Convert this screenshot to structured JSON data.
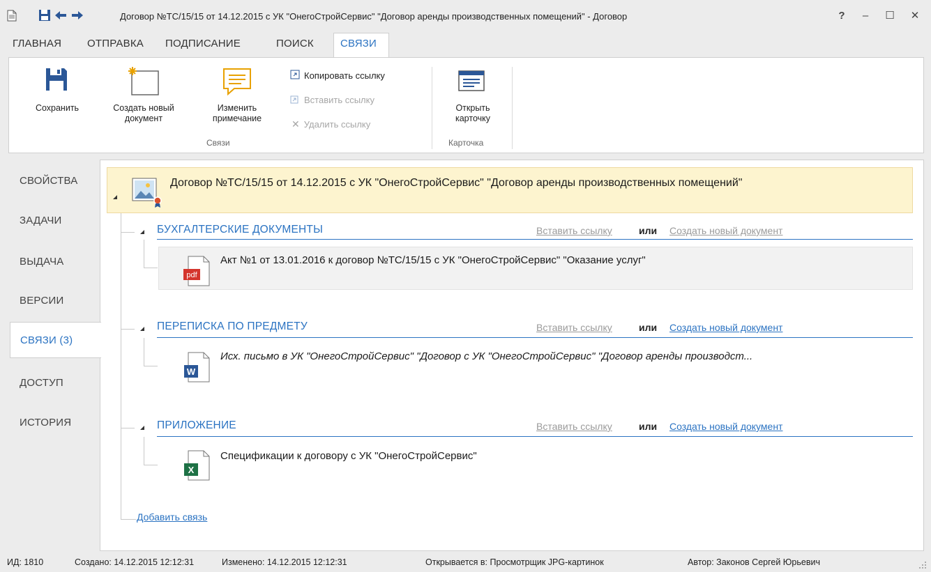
{
  "window": {
    "title": "Договор №ТС/15/15 от 14.12.2015 с УК \"ОнегоСтройСервис\" \"Договор аренды производственных помещений\" - Договор",
    "help_label": "?",
    "minimize_label": "–",
    "maximize_label": "☐",
    "close_label": "✕"
  },
  "menu": {
    "tabs": [
      {
        "label": "ГЛАВНАЯ"
      },
      {
        "label": "ОТПРАВКА"
      },
      {
        "label": "ПОДПИСАНИЕ"
      },
      {
        "label": "ПОИСК"
      },
      {
        "label": "СВЯЗИ"
      }
    ]
  },
  "ribbon": {
    "save": {
      "line1": "Сохранить",
      "icon": "floppy-disk-icon"
    },
    "create": {
      "line1": "Создать новый",
      "line2": "документ",
      "icon": "new-document-icon"
    },
    "note": {
      "line1": "Изменить",
      "line2": "примечание",
      "icon": "speech-note-icon"
    },
    "copy_link": "Копировать ссылку",
    "paste_link": "Вставить ссылку",
    "delete_link": "Удалить ссылку",
    "group_links": "Связи",
    "open_card": {
      "line1": "Открыть",
      "line2": "карточку",
      "icon": "card-icon"
    },
    "group_card": "Карточка"
  },
  "nav": {
    "items": [
      {
        "label": "СВОЙСТВА"
      },
      {
        "label": "ЗАДАЧИ"
      },
      {
        "label": "ВЫДАЧА"
      },
      {
        "label": "ВЕРСИИ"
      },
      {
        "label": "СВЯЗИ (3)"
      },
      {
        "label": "ДОСТУП"
      },
      {
        "label": "ИСТОРИЯ"
      }
    ]
  },
  "main_doc": {
    "title": "Договор №ТС/15/15 от 14.12.2015 с УК \"ОнегоСтройСервис\" \"Договор аренды производственных помещений\""
  },
  "sections": [
    {
      "title": "БУХГАЛТЕРСКИЕ ДОКУМЕНТЫ",
      "paste_link": "Вставить ссылку",
      "or": "или",
      "create_link": "Создать новый документ",
      "item": {
        "text": "Акт №1 от 13.01.2016 к договор №ТС/15/15 с УК \"ОнегоСтройСервис\" \"Оказание услуг\"",
        "badge": "pdf"
      }
    },
    {
      "title": "ПЕРЕПИСКА ПО ПРЕДМЕТУ",
      "paste_link": "Вставить ссылку",
      "or": "или",
      "create_link": "Создать новый документ",
      "item": {
        "text": "Исх. письмо в УК \"ОнегоСтройСервис\" \"Договор с УК \"ОнегоСтройСервис\" \"Договор аренды производст...",
        "badge": "W"
      }
    },
    {
      "title": "ПРИЛОЖЕНИЕ",
      "paste_link": "Вставить ссылку",
      "or": "или",
      "create_link": "Создать новый документ",
      "item": {
        "text": "Спецификации к договору с УК \"ОнегоСтройСервис\"",
        "badge": "X"
      }
    }
  ],
  "add_link": "Добавить связь",
  "status": {
    "id": "ИД: 1810",
    "created": "Создано: 14.12.2015 12:12:31",
    "modified": "Изменено: 14.12.2015 12:12:31",
    "opens_in": "Открывается в: Просмотрщик JPG-картинок",
    "author": "Автор: Законов Сергей Юрьевич"
  },
  "colors": {
    "accent": "#2b73c2",
    "highlight": "#fdf4cf",
    "pdf": "#d4352d",
    "word": "#2b5797",
    "excel": "#1e7145"
  }
}
